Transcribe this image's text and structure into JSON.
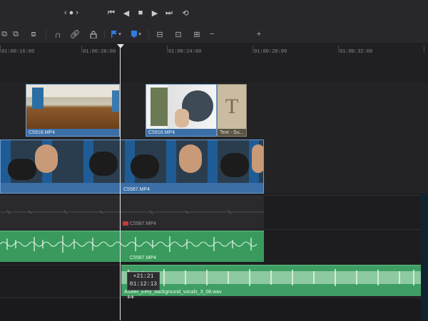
{
  "timeline": {
    "ruler_timecodes": [
      "01:00:16:00",
      "01:00:20:00",
      "01:00:24:00",
      "01:00:28:00",
      "01:00:32:00"
    ],
    "video_clips_v2": [
      {
        "name": "C5918.MP4"
      },
      {
        "name": "C5916.MP4"
      },
      {
        "name": "Text - Su..."
      }
    ],
    "title_glyph": "T",
    "video_clip_v1": {
      "name": "C5587.MP4"
    },
    "audio_clip_a1_name": "C5587.MP4",
    "audio_clip_a2_name": "C5587.MP4",
    "audio_clip_a3_name": "ASMR_Eery_background_vocals_3_08.wav",
    "drag_tooltip": {
      "offset": "+21:21",
      "timecode": "01:12:13"
    }
  },
  "colors": {
    "video_clip": "#3c6fa6",
    "audio_clip": "#3a9a5e",
    "flag_blue": "#2f7de0"
  }
}
